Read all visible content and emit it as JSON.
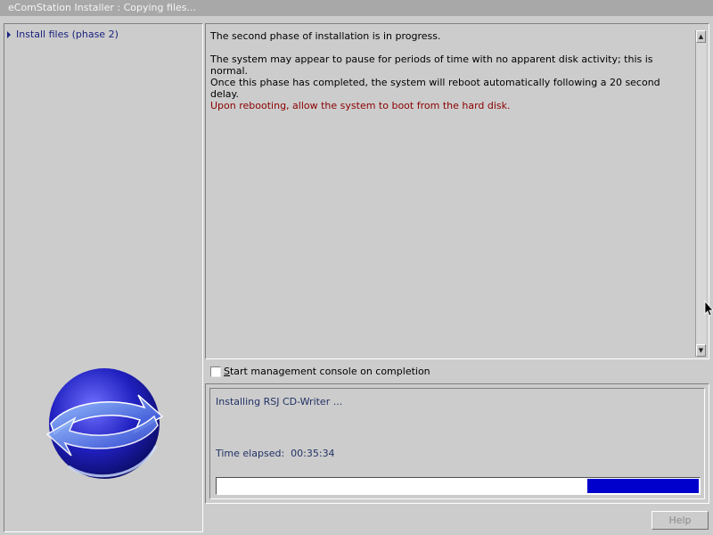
{
  "window": {
    "title": "eComStation Installer : Copying files..."
  },
  "sidebar": {
    "items": [
      {
        "label": "Install files (phase 2)",
        "icon": "arrow-right-icon"
      }
    ],
    "logo": "ecomstation-globe-logo"
  },
  "main": {
    "lines": [
      "The second phase of installation is in progress.",
      "The system may appear to pause for periods of time with no apparent disk activity; this is normal.",
      "Once this phase has completed, the system will reboot automatically following a 20 second delay.",
      "Upon rebooting, allow the system to boot from the hard disk."
    ],
    "warning_color": "#8b0000"
  },
  "options": {
    "console_checkbox_label_first": "S",
    "console_checkbox_label_rest": "tart management console on completion",
    "console_checkbox_checked": false
  },
  "status": {
    "current_task": "Installing RSJ CD-Writer ...",
    "time_elapsed_label": "Time elapsed:",
    "time_elapsed_value": "00:35:34",
    "progress_remaining_fraction": 0.23
  },
  "footer": {
    "help_label": "Help"
  },
  "colors": {
    "progress_fill": "#0000cc",
    "title_bar": "#a8a8a8",
    "background": "#cccccc"
  }
}
